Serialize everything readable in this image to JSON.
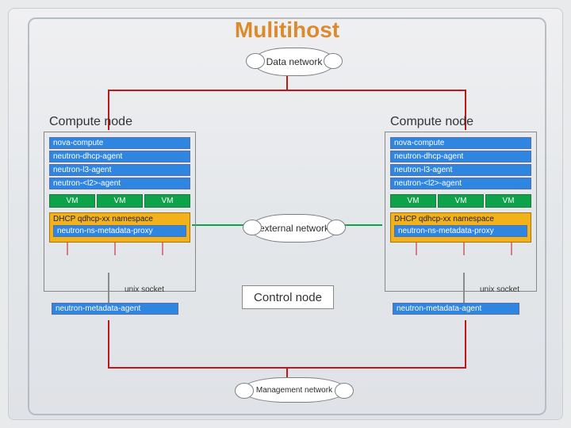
{
  "title": "Mulitihost",
  "networks": {
    "data": "Data network",
    "external": "external network",
    "management": "Management network"
  },
  "control_node": {
    "label": "Control node"
  },
  "compute_left": {
    "title": "Compute node",
    "services": [
      "nova-compute",
      "neutron-dhcp-agent",
      "neutron-l3-agent",
      "neutron-<l2>-agent"
    ],
    "vm_label": "VM",
    "dhcp_label": "DHCP qdhcp-xx namespace",
    "ns_proxy": "neutron-ns-metadata-proxy",
    "unix_socket": "unix socket",
    "metadata_agent": "neutron-metadata-agent"
  },
  "compute_right": {
    "title": "Compute node",
    "services": [
      "nova-compute",
      "neutron-dhcp-agent",
      "neutron-l3-agent",
      "neutron-<l2>-agent"
    ],
    "vm_label": "VM",
    "dhcp_label": "DHCP qdhcp-xx namespace",
    "ns_proxy": "neutron-ns-metadata-proxy",
    "unix_socket": "unix socket",
    "metadata_agent": "neutron-metadata-agent"
  },
  "colors": {
    "accent_title": "#d98b2e",
    "service_blue": "#2f86e0",
    "vm_green": "#0ea24b",
    "dhcp_orange": "#f2b21b",
    "wire_red": "#c01818",
    "wire_green": "#0ea24b"
  }
}
